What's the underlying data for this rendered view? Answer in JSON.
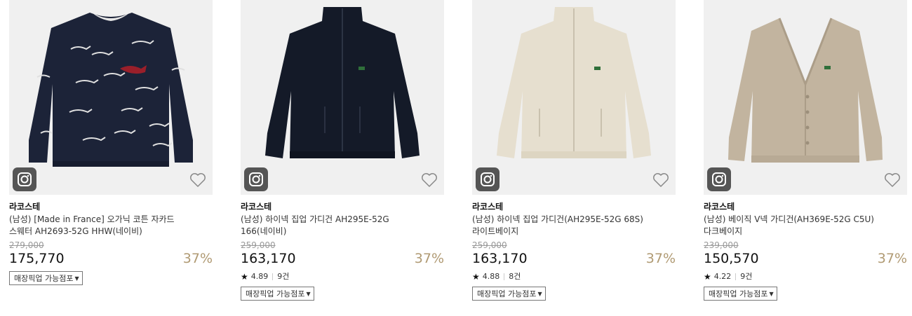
{
  "products": [
    {
      "brand": "라코스테",
      "name_line1": "(남성) [Made in France] 오가닉 코튼 자카드",
      "name_line2": "스웨터 AH2693-52G HHW(네이비)",
      "original_price": "279,000",
      "sale_price": "175,770",
      "discount": "37%",
      "rating": "",
      "review_count": "",
      "pickup_label": "매장픽업 가능점포",
      "color": "#1c2338"
    },
    {
      "brand": "라코스테",
      "name_line1": "(남성) 하이넥 집업 가디건 AH295E-52G",
      "name_line2": "166(네이비)",
      "original_price": "259,000",
      "sale_price": "163,170",
      "discount": "37%",
      "rating": "4.89",
      "review_count": "9건",
      "pickup_label": "매장픽업 가능점포",
      "color": "#141a28"
    },
    {
      "brand": "라코스테",
      "name_line1": "(남성) 하이넥 집업 가디건(AH295E-52G 68S)",
      "name_line2": "라이트베이지",
      "original_price": "259,000",
      "sale_price": "163,170",
      "discount": "37%",
      "rating": "4.88",
      "review_count": "8건",
      "pickup_label": "매장픽업 가능점포",
      "color": "#e6dfcf"
    },
    {
      "brand": "라코스테",
      "name_line1": "(남성) 베이직 V넥 가디건(AH369E-52G C5U)",
      "name_line2": "다크베이지",
      "original_price": "239,000",
      "sale_price": "150,570",
      "discount": "37%",
      "rating": "4.22",
      "review_count": "9건",
      "pickup_label": "매장픽업 가능점포",
      "color": "#c2b49f"
    }
  ],
  "icons": {
    "rating": "star-icon",
    "dropdown": "triangle-down-icon",
    "wishlist": "heart-icon",
    "instagram": "instagram-icon"
  },
  "accent_colors": {
    "discount": "#b09a73",
    "strikethrough": "#999999"
  }
}
